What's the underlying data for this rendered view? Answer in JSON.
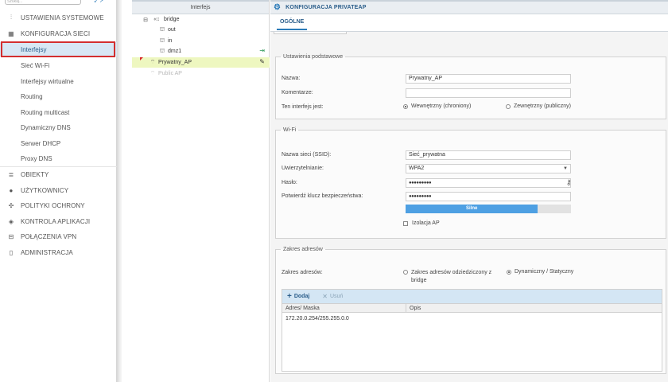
{
  "sidebar": {
    "search_placeholder": "Szukaj...",
    "sections": [
      {
        "label": "USTAWIENIA SYSTEMOWE",
        "icon": "sliders-icon"
      },
      {
        "label": "KONFIGURACJA SIECI",
        "icon": "network-icon"
      }
    ],
    "network_items": [
      {
        "label": "Interfejsy",
        "active": true
      },
      {
        "label": "Sieć Wi-Fi"
      },
      {
        "label": "Interfejsy wirtualne"
      },
      {
        "label": "Routing"
      },
      {
        "label": "Routing multicast"
      },
      {
        "label": "Dynamiczny DNS"
      },
      {
        "label": "Serwer DHCP"
      },
      {
        "label": "Proxy DNS"
      }
    ],
    "bottom_sections": [
      {
        "label": "OBIEKTY",
        "icon": "database-icon"
      },
      {
        "label": "UŻYTKOWNICY",
        "icon": "user-icon"
      },
      {
        "label": "POLITYKI OCHRONY",
        "icon": "policy-icon"
      },
      {
        "label": "KONTROLA APLIKACJI",
        "icon": "shield-icon"
      },
      {
        "label": "POŁĄCZENIA VPN",
        "icon": "vpn-icon"
      },
      {
        "label": "ADMINISTRACJA",
        "icon": "admin-icon"
      }
    ]
  },
  "tree": {
    "header": "Interfejs",
    "items": [
      {
        "label": "bridge",
        "icon": "bridge-icon"
      },
      {
        "label": "out",
        "icon": "interface-icon"
      },
      {
        "label": "in",
        "icon": "interface-icon"
      },
      {
        "label": "dmz1",
        "icon": "interface-icon"
      },
      {
        "label": "Prywatny_AP",
        "icon": "wifi-icon"
      },
      {
        "label": "Public AP",
        "icon": "wifi-icon"
      }
    ]
  },
  "main": {
    "title": "KONFIGURACJA PRIVATEAP",
    "tab": "OGÓLNE",
    "basic": {
      "legend": "Ustawienia podstawowe",
      "name_label": "Nazwa:",
      "name_value": "Prywatny_AP",
      "comment_label": "Komentarze:",
      "comment_value": "",
      "type_label": "Ten interfejs jest:",
      "internal_label": "Wewnętrzny (chroniony)",
      "external_label": "Zewnętrzny (publiczny)"
    },
    "wifi": {
      "legend": "Wi-Fi",
      "ssid_label": "Nazwa sieci (SSID):",
      "ssid_value": "Sieć_prywatna",
      "auth_label": "Uwierzytelnianie:",
      "auth_value": "WPA2",
      "password_label": "Hasło:",
      "password_value": "●●●●●●●●●",
      "confirm_label": "Potwierdź klucz bezpieczeństwa:",
      "confirm_value": "●●●●●●●●●",
      "strength_label": "Silne",
      "strength_fraction": 0.8,
      "isolation_label": "Izolacja AP"
    },
    "address": {
      "legend": "Zakres adresów",
      "range_label": "Zakres adresów:",
      "inherited_label": "Zakres adresów odziedziczony z bridge",
      "dynamic_label": "Dynamiczny / Statyczny",
      "add_label": "Dodaj",
      "remove_label": "Usuń",
      "col_address": "Adres/ Maska",
      "col_description": "Opis",
      "rows": [
        {
          "address": "172.20.0.254/255.255.0.0",
          "description": ""
        }
      ]
    }
  },
  "colors": {
    "accent": "#2a7ab8",
    "selected_row": "#eef7c0",
    "active_nav": "#d8e7f4",
    "highlight": "#d32f2f"
  }
}
